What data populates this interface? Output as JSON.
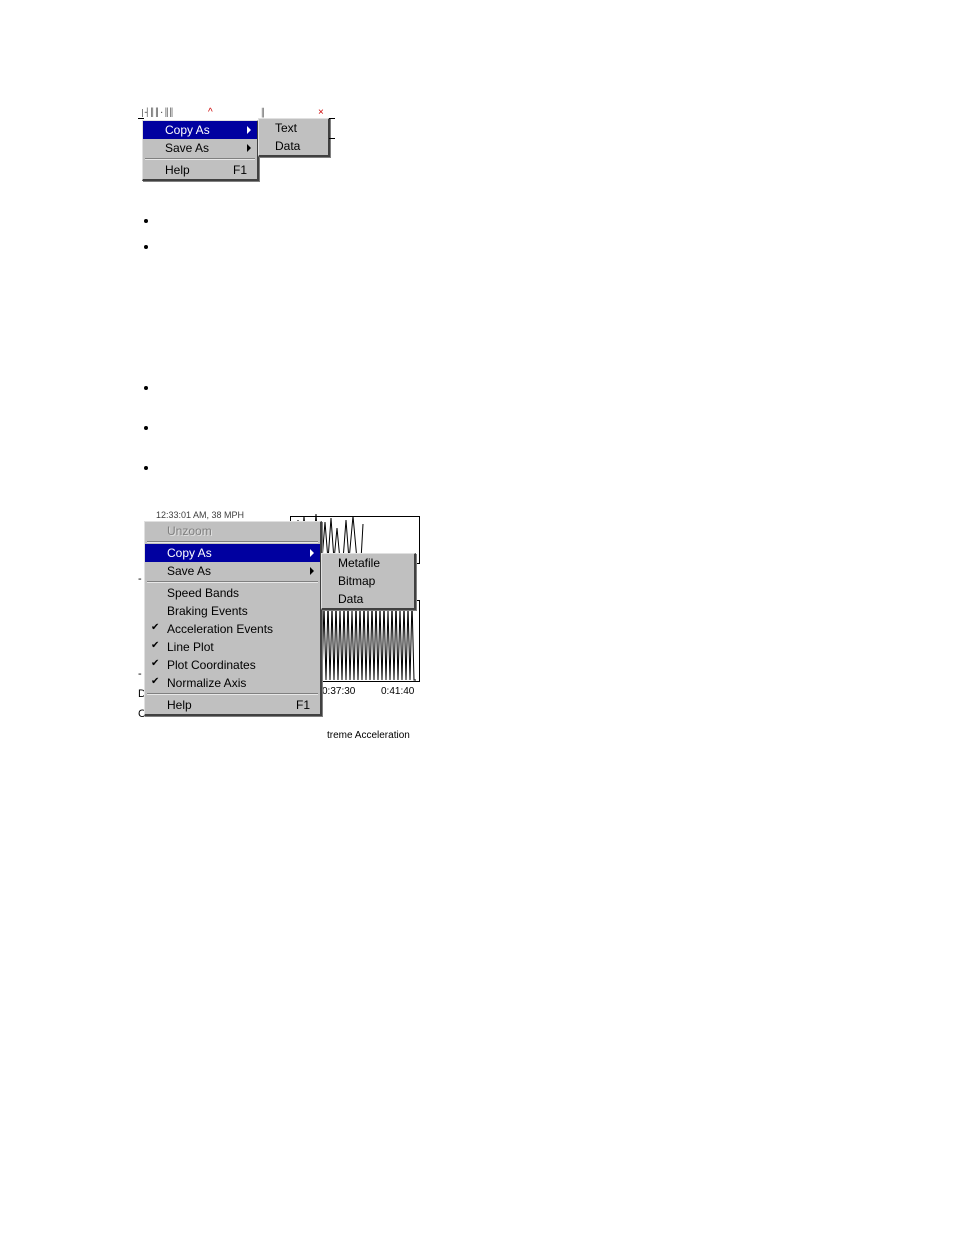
{
  "menu1": {
    "copy_as": "Copy As",
    "save_as": "Save As",
    "help": "Help",
    "help_shortcut": "F1",
    "sub": {
      "text": "Text",
      "data": "Data"
    }
  },
  "menu2": {
    "unzoom": "Unzoom",
    "copy_as": "Copy As",
    "save_as": "Save As",
    "speed_bands": "Speed Bands",
    "braking_events": "Braking Events",
    "acceleration_events": "Acceleration Events",
    "line_plot": "Line Plot",
    "plot_coordinates": "Plot Coordinates",
    "normalize_axis": "Normalize Axis",
    "help": "Help",
    "help_shortcut": "F1",
    "sub": {
      "metafile": "Metafile",
      "bitmap": "Bitmap",
      "data": "Data"
    }
  },
  "chart": {
    "title_fragment": "12:33:01 AM, 38 MPH",
    "xtick1": "0:37:30",
    "xtick2": "0:41:40",
    "legend_fragment": "treme Acceleration"
  }
}
